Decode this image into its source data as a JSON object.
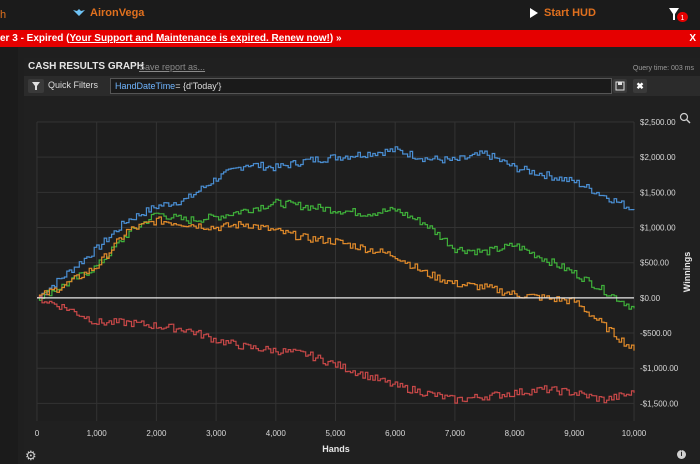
{
  "topbar": {
    "left_fragment": "h",
    "brand": "AironVega",
    "start_hud": "Start HUD",
    "filter_badge": "1"
  },
  "banner": {
    "prefix": "er 3 - Expired (",
    "link_text": "Your Support and Maintenance is expired.  Renew now!",
    "suffix": ") »",
    "close": "X"
  },
  "report": {
    "title": "CASH RESULTS GRAPH",
    "save_link": "Save report as...",
    "query_time": "Query time: 003 ms"
  },
  "quick_filters": {
    "label": "Quick Filters",
    "key": "HandDateTime",
    "value": "= {d'Today'}",
    "clear": "✖"
  },
  "colors": {
    "blue": "#4a8fd4",
    "green": "#3fb03a",
    "orange": "#e08a2a",
    "red": "#c84848",
    "zero_line": "#e8e8e8",
    "accent": "#e0701e",
    "banner": "#e50000"
  },
  "chart_data": {
    "type": "line",
    "xlabel": "Hands",
    "ylabel": "Winnings",
    "xlim": [
      0,
      10000
    ],
    "ylim": [
      -1750,
      2500
    ],
    "x_ticks": [
      0,
      1000,
      2000,
      3000,
      4000,
      5000,
      6000,
      7000,
      8000,
      9000,
      10000
    ],
    "x_tick_labels": [
      "0",
      "1,000",
      "2,000",
      "3,000",
      "4,000",
      "5,000",
      "6,000",
      "7,000",
      "8,000",
      "9,000",
      "10,000"
    ],
    "y_ticks": [
      2500,
      2000,
      1500,
      1000,
      500,
      0,
      -500,
      -1000,
      -1500
    ],
    "y_tick_labels": [
      "$2,500.00",
      "$2,000.00",
      "$1,500.00",
      "$1,000.00",
      "$500.00",
      "$0.00",
      "-$500.00",
      "-$1,000.00",
      "-$1,500.00"
    ],
    "grid": true,
    "x": [
      0,
      500,
      1000,
      1500,
      2000,
      2500,
      3000,
      3500,
      4000,
      4500,
      5000,
      5500,
      6000,
      6500,
      7000,
      7500,
      8000,
      8500,
      9000,
      9500,
      10000
    ],
    "series": [
      {
        "color_key": "blue",
        "values": [
          0,
          350,
          700,
          1100,
          1300,
          1400,
          1700,
          1900,
          1850,
          1950,
          2000,
          2050,
          2100,
          1980,
          1950,
          2050,
          1850,
          1750,
          1650,
          1450,
          1250
        ]
      },
      {
        "color_key": "green",
        "values": [
          0,
          200,
          450,
          900,
          1200,
          1100,
          1150,
          1250,
          1350,
          1300,
          1250,
          1200,
          1250,
          1050,
          700,
          650,
          750,
          550,
          350,
          100,
          -150
        ]
      },
      {
        "color_key": "orange",
        "values": [
          0,
          200,
          450,
          950,
          1100,
          1050,
          1000,
          1050,
          950,
          850,
          800,
          700,
          600,
          350,
          200,
          150,
          50,
          0,
          -50,
          -400,
          -750
        ]
      },
      {
        "color_key": "red",
        "values": [
          0,
          -150,
          -350,
          -350,
          -400,
          -450,
          -600,
          -700,
          -750,
          -800,
          -950,
          -1100,
          -1250,
          -1350,
          -1450,
          -1400,
          -1350,
          -1300,
          -1350,
          -1450,
          -1350
        ]
      }
    ]
  }
}
